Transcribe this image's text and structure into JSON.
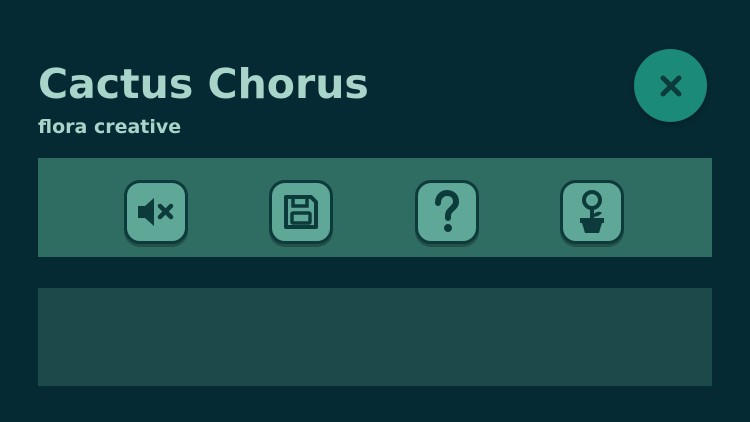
{
  "header": {
    "title": "Cactus Chorus",
    "subtitle": "flora creative"
  },
  "colors": {
    "background": "#062a33",
    "text": "#a9d4c9",
    "close_button": "#1b8a78",
    "toolbar_panel": "#2f6c62",
    "icon_button": "#5fa898",
    "icon_glyph": "#0d3a3a",
    "content_panel": "#1c4a4a"
  },
  "toolbar": {
    "buttons": [
      {
        "icon": "mute-icon"
      },
      {
        "icon": "save-icon"
      },
      {
        "icon": "help-icon"
      },
      {
        "icon": "flower-pot-icon"
      }
    ]
  },
  "close_button": {
    "icon": "close-icon"
  }
}
